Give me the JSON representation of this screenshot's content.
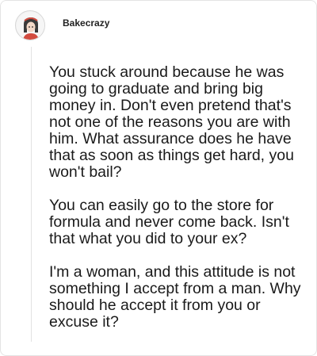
{
  "post": {
    "username": "Bakecrazy",
    "paragraphs": [
      "You stuck around because he was going to graduate and bring big money in. Don't even pretend that's not one of the reasons you are with him. What assurance does he have that as soon as things get hard, you won't bail?",
      "You can easily go to the store for formula and never come back. Isn't that what you did to your ex?",
      "I'm a woman, and this attitude is not something I accept from a man. Why should he accept it from you or excuse it?"
    ]
  },
  "icons": {
    "avatar": "user-avatar-icon"
  },
  "colors": {
    "text": "#1a1a1a",
    "username": "#222222",
    "border": "#e4e4e4",
    "thread_line": "#e2e2e2",
    "avatar_accent": "#d24b3f"
  }
}
